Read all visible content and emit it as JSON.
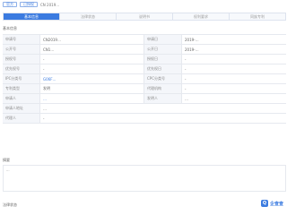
{
  "header": {
    "tag_a": "官方",
    "tag_b": "已授权",
    "patent_no": "CN 2019…"
  },
  "tabs": [
    {
      "label": "基本信息"
    },
    {
      "label": "法律状态"
    },
    {
      "label": "说明书"
    },
    {
      "label": "权利要求"
    },
    {
      "label": "同族专利"
    }
  ],
  "basic_info_title": "基本信息",
  "abstract_title": "摘要",
  "legal_title": "法律状态",
  "rows": [
    {
      "l1": "申请号",
      "v1": "CN2019…",
      "l2": "申请日",
      "v2": "2019-…"
    },
    {
      "l1": "公开号",
      "v1": "CN1…",
      "l2": "公开日",
      "v2": "2019-…"
    },
    {
      "l1": "授权号",
      "v1": "-",
      "l2": "授权日",
      "v2": "-"
    },
    {
      "l1": "优先权号",
      "v1": "-",
      "l2": "优先权日",
      "v2": "-"
    },
    {
      "l1": "IPC分类号",
      "v1": "G06F…",
      "l2": "CPC分类号",
      "v2": "-"
    },
    {
      "l1": "专利类型",
      "v1": "发明",
      "l2": "代理机构",
      "v2": "-"
    },
    {
      "l1": "申请人",
      "v1": "…",
      "l2": "发明人",
      "v2": "…"
    }
  ],
  "address_label": "申请人地址",
  "address_value": "…",
  "agency_label": "代理人",
  "agency_value": "-",
  "abstract_text": "…",
  "logo_text": "企查查"
}
